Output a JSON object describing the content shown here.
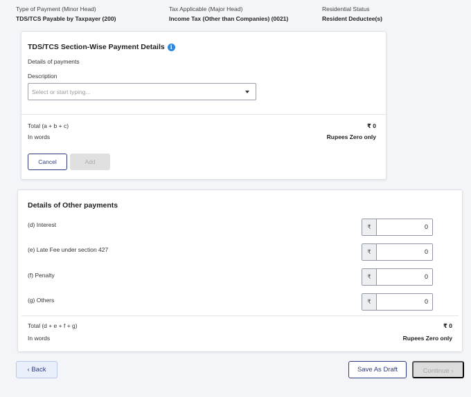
{
  "summary": [
    {
      "label": "Type of Payment (Minor Head)",
      "value": "TDS/TCS Payable by Taxpayer (200)"
    },
    {
      "label": "Tax Applicable (Major Head)",
      "value": "Income Tax (Other than Companies) (0021)"
    },
    {
      "label": "Residential Status",
      "value": "Resident Deductee(s)"
    }
  ],
  "section_card": {
    "title": "TDS/TCS Section-Wise Payment Details",
    "info_icon_glyph": "i",
    "subtitle": "Details of payments",
    "description_label": "Description",
    "description_placeholder": "Select or start typing...",
    "total_label": "Total (a + b + c)",
    "total_value": "₹ 0",
    "in_words_label": "In words",
    "in_words_value": "Rupees Zero only",
    "cancel_label": "Cancel",
    "add_label": "Add"
  },
  "other_card": {
    "title": "Details of Other payments",
    "currency_symbol": "₹",
    "rows": [
      {
        "label": "(d) Interest",
        "value": "0"
      },
      {
        "label": "(e) Late Fee under section 427",
        "value": "0"
      },
      {
        "label": "(f) Penalty",
        "value": "0"
      },
      {
        "label": "(g) Others",
        "value": "0"
      }
    ],
    "total_label": "Total (d + e + f + g)",
    "total_value": "₹ 0",
    "in_words_label": "In words",
    "in_words_value": "Rupees Zero only"
  },
  "footer": {
    "back_chevron": "‹",
    "back_label": "Back",
    "save_draft_label": "Save As Draft",
    "continue_label": "Continue",
    "continue_chevron": "›"
  },
  "colors": {
    "primary": "#2d3a7a",
    "info": "#2d88e0",
    "disabled_bg": "#dcdcdc"
  }
}
